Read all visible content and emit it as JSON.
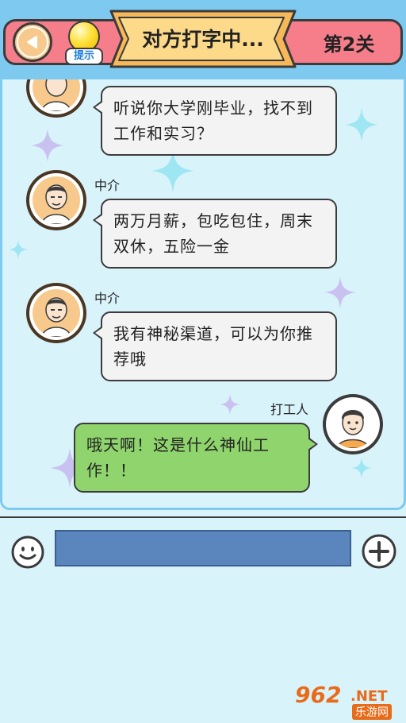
{
  "header": {
    "hint_label": "提示",
    "title": "对方打字中...",
    "level": "第2关"
  },
  "messages": [
    {
      "side": "left",
      "sender": "",
      "text": "听说你大学刚毕业，找不到工作和实习？"
    },
    {
      "side": "left",
      "sender": "中介",
      "text": "两万月薪，包吃包住，周末双休，五险一金"
    },
    {
      "side": "left",
      "sender": "中介",
      "text": "我有神秘渠道，可以为你推荐哦"
    },
    {
      "side": "right",
      "sender": "打工人",
      "text": "哦天啊！这是什么神仙工作！！"
    }
  ],
  "input": {
    "value": "",
    "placeholder": ""
  },
  "watermark": {
    "number": "962",
    "suffix": ".NET",
    "site": "乐游网"
  },
  "colors": {
    "header_bar": "#f57e8a",
    "sky": "#7ec9ef",
    "chat_bg": "#d9f3fb",
    "left_bubble": "#f3f3f3",
    "right_bubble": "#8fd46c",
    "input_field": "#5b86bd"
  }
}
